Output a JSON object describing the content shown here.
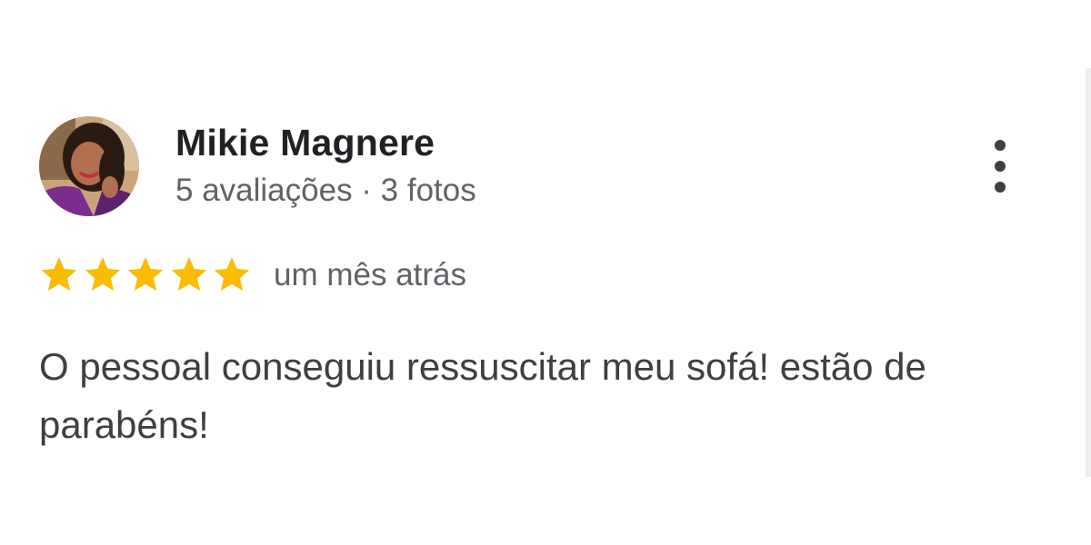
{
  "reviewer": {
    "name": "Mikie Magnere",
    "meta": "5 avaliações · 3 fotos",
    "avatar_icon": "profile-photo"
  },
  "review": {
    "rating": 5,
    "max_rating": 5,
    "time": "um mês atrás",
    "text": "O pessoal conseguiu ressuscitar meu sofá! estão de parabéns!"
  },
  "menu": {
    "icon": "more-vert-icon"
  },
  "colors": {
    "star": "#FBBC04",
    "name": "#202124",
    "secondary": "#5f6368",
    "body": "#3c4043",
    "avatar_top": "#6b3a1e",
    "avatar_bottom": "#7b2d8e"
  }
}
